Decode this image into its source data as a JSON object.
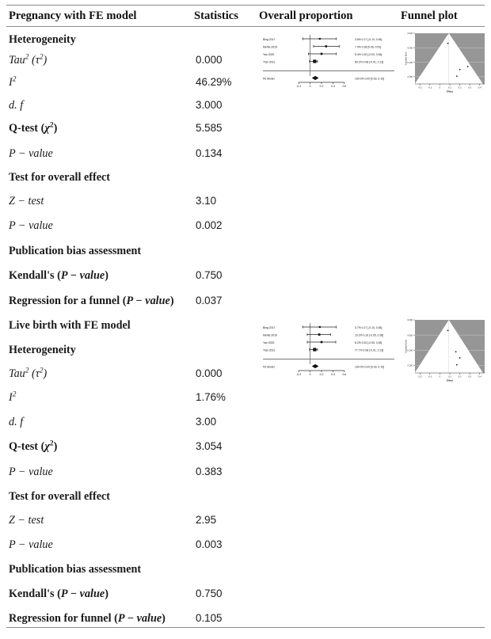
{
  "table": {
    "headers": {
      "col1": "Pregnancy with FE model",
      "col2": "Statistics",
      "col3": "Overall proportion",
      "col4": "Funnel plot"
    },
    "section2_title": "Live birth with FE model",
    "labels": {
      "heterogeneity": "Heterogeneity",
      "tau2_pre": "Tau",
      "tau2_paren_open": " (",
      "tau_sym": "τ",
      "tau2_paren_close": ")",
      "i2": "I",
      "df": "d. f",
      "qtest_pre": "Q-test (",
      "chi_sym": "χ",
      "qtest_post": ")",
      "pvalue": "P − value",
      "test_overall": "Test for overall effect",
      "ztest": "Z − test",
      "pub_bias": "Publication bias assessment",
      "kendall_pre": "Kendall's (",
      "kendall_post": ")",
      "regression_a_pre": "Regression for a funnel (",
      "regression_pre": "Regression for funnel (",
      "regression_post": ")"
    },
    "pregnancy": {
      "tau2": "0.000",
      "i2": "46.29%",
      "df": "3.000",
      "qtest": "5.585",
      "het_pvalue": "0.134",
      "ztest": "3.10",
      "z_pvalue": "0.002",
      "kendall": "0.750",
      "regression": "0.037"
    },
    "livebirth": {
      "tau2": "0.000",
      "i2": "1.76%",
      "df": "3.00",
      "qtest": "3.054",
      "het_pvalue": "0.383",
      "ztest": "2.95",
      "z_pvalue": "0.003",
      "kendall": "0.750",
      "regression": "0.105"
    }
  },
  "chart_data": [
    {
      "id": "forest-pregnancy",
      "type": "forest",
      "title": "Overall proportion — Pregnancy (FE model)",
      "xlabel": "",
      "xticks": [
        "-0.2",
        "0",
        "0.2",
        "0.4",
        "0.6"
      ],
      "xlim": [
        -0.3,
        0.7
      ],
      "studies": [
        {
          "name": "Bing 2017",
          "weight": "3.6%",
          "effect": 0.17,
          "ci_low": -0.13,
          "ci_high": 0.46,
          "label": "0.17 [-0.13, 0.46]"
        },
        {
          "name": "Mehta 2019",
          "weight": "7.4%",
          "effect": 0.28,
          "ci_low": 0.06,
          "ci_high": 0.51,
          "label": "0.28 [0.06, 0.51]"
        },
        {
          "name": "Yan 2020",
          "weight": "8.4%",
          "effect": 0.2,
          "ci_low": -0.03,
          "ci_high": 0.46,
          "label": "0.20 [-0.03, 0.46]"
        },
        {
          "name": "Tran 2021",
          "weight": "80.2%",
          "effect": 0.08,
          "ci_low": -0.01,
          "ci_high": 0.13,
          "label": "0.08 [-0.01, 0.13]"
        }
      ],
      "summary": {
        "name": "FE Model",
        "weight": "100.0%",
        "effect": 0.09,
        "ci_low": 0.03,
        "ci_high": 0.15,
        "label": "0.09 [0.03, 0.15]"
      }
    },
    {
      "id": "funnel-pregnancy",
      "type": "funnel",
      "title": "Funnel plot — Pregnancy (FE model)",
      "xlabel": "Effect",
      "ylabel": "Standard Error",
      "xticks": [
        "-0.2",
        "-0.1",
        "0",
        "0.1",
        "0.2",
        "0.3",
        "0.4"
      ],
      "points": [
        {
          "x": 0.17,
          "se": 0.148
        },
        {
          "x": 0.28,
          "se": 0.115
        },
        {
          "x": 0.2,
          "se": 0.125
        },
        {
          "x": 0.08,
          "se": 0.035
        }
      ],
      "center": 0.09
    },
    {
      "id": "forest-livebirth",
      "type": "forest",
      "title": "Overall proportion — Live birth (FE model)",
      "xlabel": "",
      "xticks": [
        "-0.2",
        "0",
        "0.2",
        "0.4",
        "0.6"
      ],
      "xlim": [
        -0.3,
        0.7
      ],
      "studies": [
        {
          "name": "Bing 2017",
          "weight": "3.7%",
          "effect": 0.17,
          "ci_low": -0.13,
          "ci_high": 0.46,
          "label": "0.17 [-0.13, 0.46]"
        },
        {
          "name": "Mehta 2019",
          "weight": "10.2%",
          "effect": 0.16,
          "ci_low": -0.05,
          "ci_high": 0.36,
          "label": "0.16 [-0.05, 0.36]"
        },
        {
          "name": "Yan 2020",
          "weight": "8.2%",
          "effect": 0.2,
          "ci_low": -0.05,
          "ci_high": 0.45,
          "label": "0.20 [-0.05, 0.45]"
        },
        {
          "name": "Tran 2021",
          "weight": "77.7%",
          "effect": 0.08,
          "ci_low": -0.01,
          "ci_high": 0.13,
          "label": "0.08 [-0.01, 0.13]"
        }
      ],
      "summary": {
        "name": "FE Model",
        "weight": "100.0%",
        "effect": 0.09,
        "ci_low": 0.03,
        "ci_high": 0.15,
        "label": "0.09 [0.03, 0.15]"
      }
    },
    {
      "id": "funnel-livebirth",
      "type": "funnel",
      "title": "Funnel plot — Live birth (FE model)",
      "xlabel": "Effect",
      "ylabel": "Standard Error",
      "xticks": [
        "-0.2",
        "-0.1",
        "0",
        "0.1",
        "0.2",
        "0.3",
        "0.4"
      ],
      "points": [
        {
          "x": 0.17,
          "se": 0.148
        },
        {
          "x": 0.16,
          "se": 0.105
        },
        {
          "x": 0.2,
          "se": 0.125
        },
        {
          "x": 0.08,
          "se": 0.035
        }
      ],
      "center": 0.09
    }
  ]
}
